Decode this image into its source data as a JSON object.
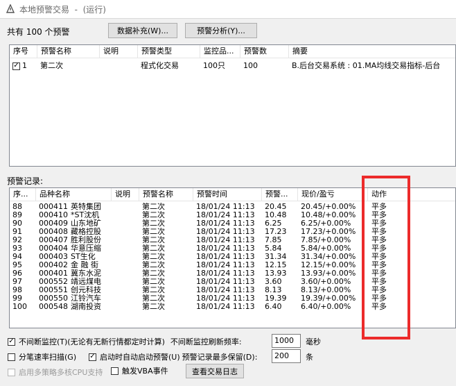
{
  "window": {
    "title": "本地预警交易  -  (运行)"
  },
  "toolbar": {
    "count_label": "共有 100 个预警",
    "data_supplement_button": "数据补充(W)...",
    "analysis_button": "预警分析(Y)..."
  },
  "alerts_table": {
    "columns": [
      "序号",
      "预警名称",
      "说明",
      "预警类型",
      "监控品...",
      "预警数",
      "摘要"
    ],
    "rows": [
      {
        "checked": true,
        "seq": "1",
        "name": "第二次",
        "desc": "",
        "type": "程式化交易",
        "monitor": "100只",
        "count": "100",
        "summary": "B.后台交易系统 : 01.MA均线交易指标-后台"
      }
    ]
  },
  "records": {
    "label": "预警记录:",
    "columns": [
      "序...",
      "品种名称",
      "说明",
      "预警名称",
      "预警时间",
      "预警...",
      "现价/盈亏",
      "动作"
    ],
    "rows": [
      {
        "seq": "88",
        "code": "000411",
        "name": "英特集团",
        "desc": "",
        "alert": "第二次",
        "time": "18/01/24 11:13",
        "price": "20.45",
        "pnl": "20.45/+0.00%",
        "action": "平多"
      },
      {
        "seq": "89",
        "code": "000410",
        "name": "*ST沈机",
        "desc": "",
        "alert": "第二次",
        "time": "18/01/24 11:13",
        "price": "10.48",
        "pnl": "10.48/+0.00%",
        "action": "平多"
      },
      {
        "seq": "90",
        "code": "000409",
        "name": "山东地矿",
        "desc": "",
        "alert": "第二次",
        "time": "18/01/24 11:13",
        "price": "6.25",
        "pnl": "6.25/+0.00%",
        "action": "平多"
      },
      {
        "seq": "91",
        "code": "000408",
        "name": "藏格控股",
        "desc": "",
        "alert": "第二次",
        "time": "18/01/24 11:13",
        "price": "17.23",
        "pnl": "17.23/+0.00%",
        "action": "平多"
      },
      {
        "seq": "92",
        "code": "000407",
        "name": "胜利股份",
        "desc": "",
        "alert": "第二次",
        "time": "18/01/24 11:13",
        "price": "7.85",
        "pnl": "7.85/+0.00%",
        "action": "平多"
      },
      {
        "seq": "93",
        "code": "000404",
        "name": "华意压缩",
        "desc": "",
        "alert": "第二次",
        "time": "18/01/24 11:13",
        "price": "5.84",
        "pnl": "5.84/+0.00%",
        "action": "平多"
      },
      {
        "seq": "94",
        "code": "000403",
        "name": "ST生化",
        "desc": "",
        "alert": "第二次",
        "time": "18/01/24 11:13",
        "price": "31.34",
        "pnl": "31.34/+0.00%",
        "action": "平多"
      },
      {
        "seq": "95",
        "code": "000402",
        "name": "金 融 街",
        "desc": "",
        "alert": "第二次",
        "time": "18/01/24 11:13",
        "price": "12.15",
        "pnl": "12.15/+0.00%",
        "action": "平多"
      },
      {
        "seq": "96",
        "code": "000401",
        "name": "冀东水泥",
        "desc": "",
        "alert": "第二次",
        "time": "18/01/24 11:13",
        "price": "13.93",
        "pnl": "13.93/+0.00%",
        "action": "平多"
      },
      {
        "seq": "97",
        "code": "000552",
        "name": "靖远煤电",
        "desc": "",
        "alert": "第二次",
        "time": "18/01/24 11:13",
        "price": "3.60",
        "pnl": "3.60/+0.00%",
        "action": "平多"
      },
      {
        "seq": "98",
        "code": "000551",
        "name": "创元科技",
        "desc": "",
        "alert": "第二次",
        "time": "18/01/24 11:13",
        "price": "8.13",
        "pnl": "8.13/+0.00%",
        "action": "平多"
      },
      {
        "seq": "99",
        "code": "000550",
        "name": "江铃汽车",
        "desc": "",
        "alert": "第二次",
        "time": "18/01/24 11:13",
        "price": "19.39",
        "pnl": "19.39/+0.00%",
        "action": "平多"
      },
      {
        "seq": "100",
        "code": "000548",
        "name": "湖南投资",
        "desc": "",
        "alert": "第二次",
        "time": "18/01/24 11:13",
        "price": "6.40",
        "pnl": "6.40/+0.00%",
        "action": "平多"
      }
    ]
  },
  "options": {
    "continuous_monitor": {
      "checked": true,
      "label": "不间断监控(T)(无论有无新行情都定时计算)"
    },
    "refresh_label": "不间断监控刷新频率:",
    "refresh_value": "1000",
    "refresh_unit": "毫秒",
    "tick_scan": {
      "checked": false,
      "label": "分笔速率扫描(G)"
    },
    "auto_start": {
      "checked": true,
      "label": "启动时自动启动预警(U)"
    },
    "max_records_label": "预警记录最多保留(D):",
    "max_records_value": "200",
    "max_records_unit": "条",
    "multi_strategy": {
      "checked": false,
      "label": "启用多策略多核CPU支持"
    },
    "vba_trigger": {
      "checked": false,
      "label": "触发VBA事件"
    },
    "view_log_button": "查看交易日志"
  },
  "colors": {
    "highlight_border": "#ec2b2b"
  }
}
